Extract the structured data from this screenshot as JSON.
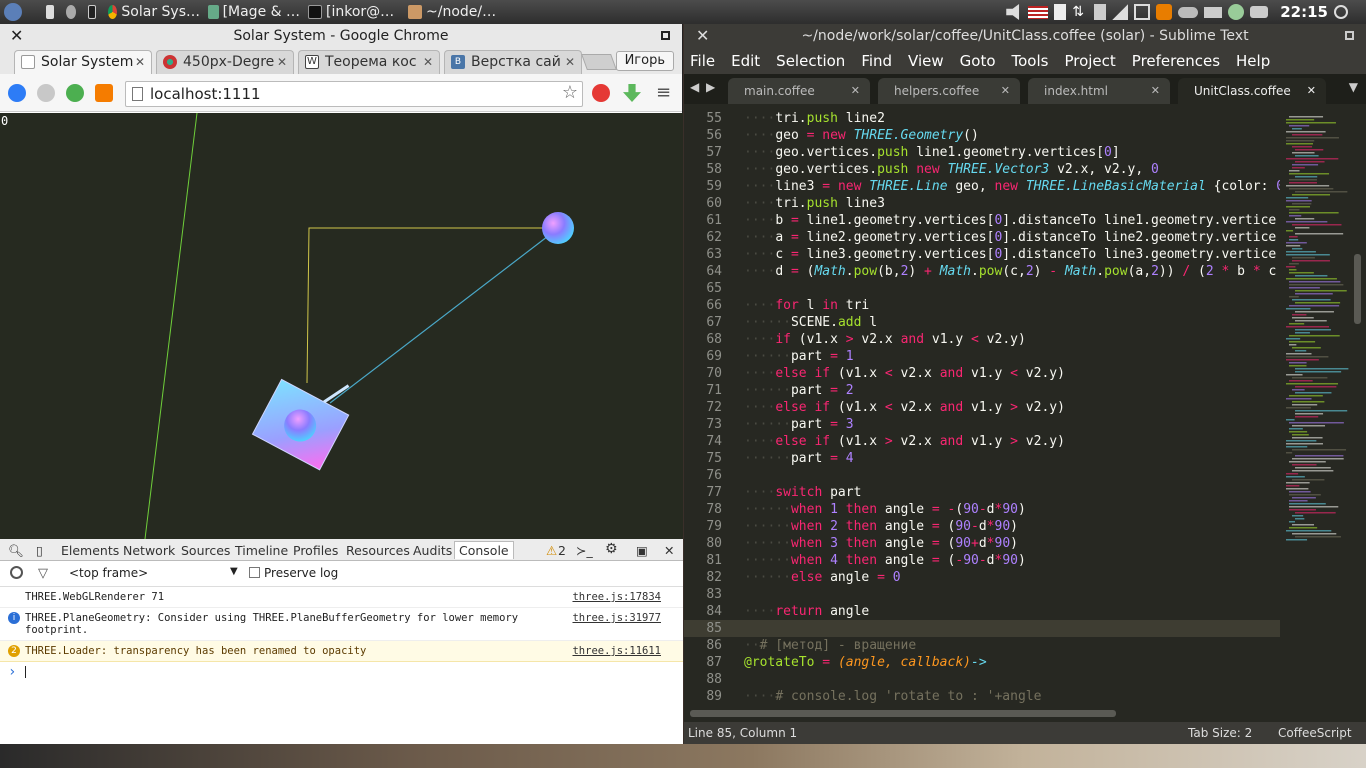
{
  "panel": {
    "tasks": [
      "Solar Sys…",
      "[Mage & …",
      "[inkor@…",
      "~/node/…"
    ],
    "clock": "22:15"
  },
  "chrome": {
    "window_title": "Solar System - Google Chrome",
    "tabs": [
      {
        "label": "Solar System",
        "fav": "#9a9a9a"
      },
      {
        "label": "450px-Degre",
        "fav": "#c0392b"
      },
      {
        "label": "Теорема кос",
        "fav": "#444444"
      },
      {
        "label": "Верстка сай",
        "fav": "#4a76a8"
      }
    ],
    "user": "Игорь",
    "url": "localhost:1111",
    "scene_label": "0"
  },
  "devtools": {
    "tabs": [
      "Elements",
      "Network",
      "Sources",
      "Timeline",
      "Profiles",
      "Resources",
      "Audits",
      "Console"
    ],
    "warn_count": "2",
    "frame": "<top frame>",
    "preserve_log": "Preserve log",
    "logs": [
      {
        "text": "THREE.WebGLRenderer 71",
        "src": "three.js:17834",
        "level": "log"
      },
      {
        "text": "THREE.PlaneGeometry: Consider using THREE.PlaneBufferGeometry for lower memory footprint.",
        "src": "three.js:31977",
        "level": "info"
      },
      {
        "text": "THREE.Loader: transparency has been renamed to opacity",
        "src": "three.js:11611",
        "level": "warn",
        "count": "2"
      }
    ],
    "prompt": "›"
  },
  "sublime": {
    "window_title": "~/node/work/solar/coffee/UnitClass.coffee (solar) - Sublime Text",
    "menu": [
      "File",
      "Edit",
      "Selection",
      "Find",
      "View",
      "Goto",
      "Tools",
      "Project",
      "Preferences",
      "Help"
    ],
    "tabs": [
      "main.coffee",
      "helpers.coffee",
      "index.html",
      "UnitClass.coffee"
    ],
    "status_left": "Line 85, Column 1",
    "status_tab": "Tab Size: 2",
    "status_syntax": "CoffeeScript",
    "current_line": 85,
    "lines": [
      {
        "n": 55,
        "html": "<span class='dt'>····</span>tri.<span class='fn'>push</span> line2"
      },
      {
        "n": 56,
        "html": "<span class='dt'>····</span>geo <span class='kw'>=</span> <span class='kw'>new</span> <span class='cl'>THREE.Geometry</span>()"
      },
      {
        "n": 57,
        "html": "<span class='dt'>····</span>geo.vertices.<span class='fn'>push</span> line1.geometry.vertices[<span class='nm'>0</span>]"
      },
      {
        "n": 58,
        "html": "<span class='dt'>····</span>geo.vertices.<span class='fn'>push</span> <span class='kw'>new</span> <span class='cl'>THREE.Vector3</span> v2.x, v2.y, <span class='nm'>0</span>"
      },
      {
        "n": 59,
        "html": "<span class='dt'>····</span>line3 <span class='kw'>=</span> <span class='kw'>new</span> <span class='cl'>THREE.Line</span> geo, <span class='kw'>new</span> <span class='cl'>THREE.LineBasicMaterial</span> {color: <span class='nm'>0</span>"
      },
      {
        "n": 60,
        "html": "<span class='dt'>····</span>tri.<span class='fn'>push</span> line3"
      },
      {
        "n": 61,
        "html": "<span class='dt'>····</span>b <span class='kw'>=</span> line1.geometry.vertices[<span class='nm'>0</span>].distanceTo line1.geometry.vertice"
      },
      {
        "n": 62,
        "html": "<span class='dt'>····</span>a <span class='kw'>=</span> line2.geometry.vertices[<span class='nm'>0</span>].distanceTo line2.geometry.vertice"
      },
      {
        "n": 63,
        "html": "<span class='dt'>····</span>c <span class='kw'>=</span> line3.geometry.vertices[<span class='nm'>0</span>].distanceTo line3.geometry.vertice"
      },
      {
        "n": 64,
        "html": "<span class='dt'>····</span>d <span class='kw'>=</span> (<span class='cl'>Math</span>.<span class='fn'>pow</span>(b,<span class='nm'>2</span>) <span class='kw'>+</span> <span class='cl'>Math</span>.<span class='fn'>pow</span>(c,<span class='nm'>2</span>) <span class='kw'>-</span> <span class='cl'>Math</span>.<span class='fn'>pow</span>(a,<span class='nm'>2</span>)) <span class='kw'>/</span> (<span class='nm'>2</span> <span class='kw'>*</span> b <span class='kw'>*</span> c"
      },
      {
        "n": 65,
        "html": ""
      },
      {
        "n": 66,
        "html": "<span class='dt'>····</span><span class='kw'>for</span> l <span class='kw'>in</span> tri"
      },
      {
        "n": 67,
        "html": "<span class='dt'>······</span>SCENE.<span class='fn'>add</span> l"
      },
      {
        "n": 68,
        "html": "<span class='dt'>····</span><span class='kw'>if</span> (v1.x <span class='kw'>&gt;</span> v2.x <span class='kw'>and</span> v1.y <span class='kw'>&lt;</span> v2.y)"
      },
      {
        "n": 69,
        "html": "<span class='dt'>······</span>part <span class='kw'>=</span> <span class='nm'>1</span>"
      },
      {
        "n": 70,
        "html": "<span class='dt'>····</span><span class='kw'>else</span> <span class='kw'>if</span> (v1.x <span class='kw'>&lt;</span> v2.x <span class='kw'>and</span> v1.y <span class='kw'>&lt;</span> v2.y)"
      },
      {
        "n": 71,
        "html": "<span class='dt'>······</span>part <span class='kw'>=</span> <span class='nm'>2</span>"
      },
      {
        "n": 72,
        "html": "<span class='dt'>····</span><span class='kw'>else</span> <span class='kw'>if</span> (v1.x <span class='kw'>&lt;</span> v2.x <span class='kw'>and</span> v1.y <span class='kw'>&gt;</span> v2.y)"
      },
      {
        "n": 73,
        "html": "<span class='dt'>······</span>part <span class='kw'>=</span> <span class='nm'>3</span>"
      },
      {
        "n": 74,
        "html": "<span class='dt'>····</span><span class='kw'>else</span> <span class='kw'>if</span> (v1.x <span class='kw'>&gt;</span> v2.x <span class='kw'>and</span> v1.y <span class='kw'>&gt;</span> v2.y)"
      },
      {
        "n": 75,
        "html": "<span class='dt'>······</span>part <span class='kw'>=</span> <span class='nm'>4</span>"
      },
      {
        "n": 76,
        "html": ""
      },
      {
        "n": 77,
        "html": "<span class='dt'>····</span><span class='kw'>switch</span> part"
      },
      {
        "n": 78,
        "html": "<span class='dt'>······</span><span class='kw'>when</span> <span class='nm'>1</span> <span class='kw'>then</span> angle <span class='kw'>=</span> <span class='kw'>-</span>(<span class='nm'>90</span><span class='kw'>-</span>d<span class='kw'>*</span><span class='nm'>90</span>)"
      },
      {
        "n": 79,
        "html": "<span class='dt'>······</span><span class='kw'>when</span> <span class='nm'>2</span> <span class='kw'>then</span> angle <span class='kw'>=</span> (<span class='nm'>90</span><span class='kw'>-</span>d<span class='kw'>*</span><span class='nm'>90</span>)"
      },
      {
        "n": 80,
        "html": "<span class='dt'>······</span><span class='kw'>when</span> <span class='nm'>3</span> <span class='kw'>then</span> angle <span class='kw'>=</span> (<span class='nm'>90</span><span class='kw'>+</span>d<span class='kw'>*</span><span class='nm'>90</span>)"
      },
      {
        "n": 81,
        "html": "<span class='dt'>······</span><span class='kw'>when</span> <span class='nm'>4</span> <span class='kw'>then</span> angle <span class='kw'>=</span> (<span class='kw'>-</span><span class='nm'>90</span><span class='kw'>-</span>d<span class='kw'>*</span><span class='nm'>90</span>)"
      },
      {
        "n": 82,
        "html": "<span class='dt'>······</span><span class='kw'>else</span> angle <span class='kw'>=</span> <span class='nm'>0</span>"
      },
      {
        "n": 83,
        "html": ""
      },
      {
        "n": 84,
        "html": "<span class='dt'>····</span><span class='kw'>return</span> angle"
      },
      {
        "n": 85,
        "html": ""
      },
      {
        "n": 86,
        "html": "<span class='dt'>··</span><span class='cm'># [метод] - вращение</span>"
      },
      {
        "n": 87,
        "html": "<span class='fn'>@rotateTo</span> <span class='kw'>=</span> <span class='pa'>(angle, callback)</span><span class='cl'>-&gt;</span>"
      },
      {
        "n": 88,
        "html": ""
      },
      {
        "n": 89,
        "html": "<span class='dt'>····</span><span class='cm'># console.log 'rotate to : '+angle</span>"
      }
    ]
  }
}
